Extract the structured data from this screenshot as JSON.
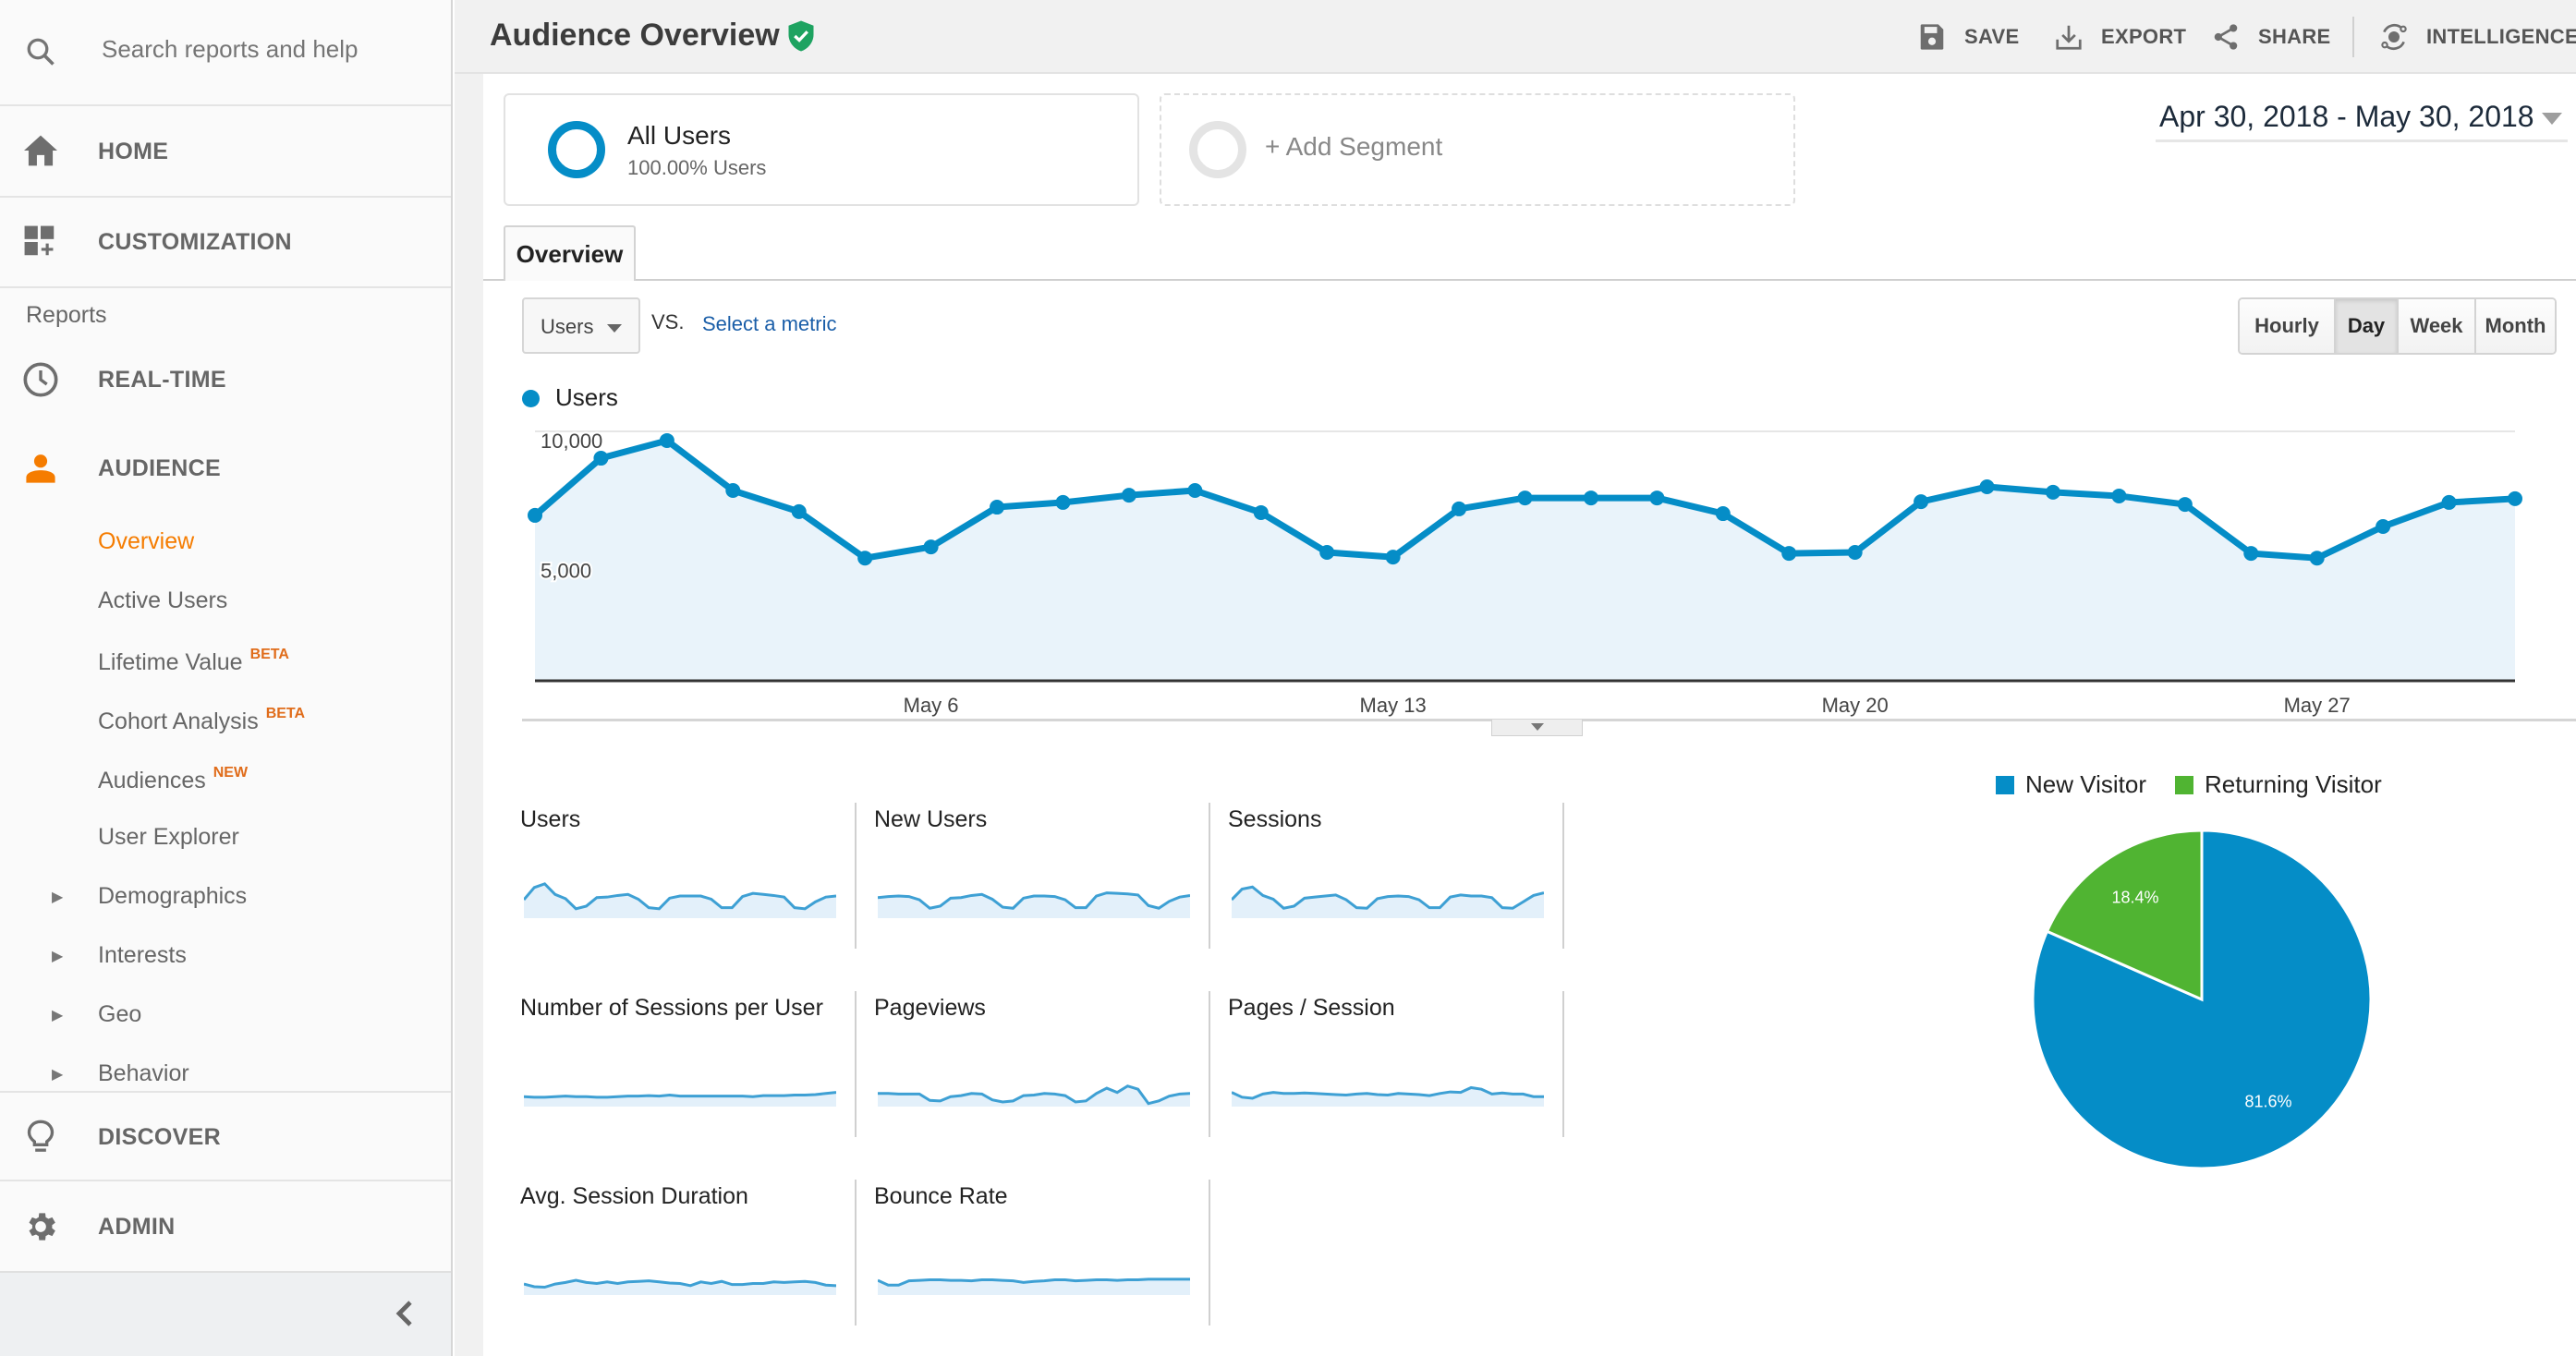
{
  "sidebar": {
    "search_placeholder": "Search reports and help",
    "home": "HOME",
    "customization": "CUSTOMIZATION",
    "reports_heading": "Reports",
    "realtime": "REAL-TIME",
    "audience": "AUDIENCE",
    "audience_items": [
      {
        "label": "Overview",
        "badge": "",
        "active": true
      },
      {
        "label": "Active Users",
        "badge": ""
      },
      {
        "label": "Lifetime Value",
        "badge": "BETA"
      },
      {
        "label": "Cohort Analysis",
        "badge": "BETA"
      },
      {
        "label": "Audiences",
        "badge": "NEW"
      },
      {
        "label": "User Explorer",
        "badge": ""
      }
    ],
    "expandable_items": [
      "Demographics",
      "Interests",
      "Geo",
      "Behavior"
    ],
    "discover": "DISCOVER",
    "admin": "ADMIN",
    "accent_color": "#f57c00"
  },
  "header": {
    "title": "Audience Overview",
    "verified_icon": "shield-check-icon",
    "actions": [
      {
        "label": "SAVE",
        "icon": "save-icon"
      },
      {
        "label": "EXPORT",
        "icon": "export-icon"
      },
      {
        "label": "SHARE",
        "icon": "share-icon"
      },
      {
        "label": "INTELLIGENCE",
        "icon": "intelligence-icon"
      }
    ]
  },
  "segments": {
    "active": {
      "title": "All Users",
      "subtitle": "100.00% Users"
    },
    "add_label": "+ Add Segment"
  },
  "date_range": "Apr 30, 2018 - May 30, 2018",
  "tabs": [
    "Overview"
  ],
  "metric_selector": {
    "selected": "Users",
    "vs_label": "VS.",
    "select_link": "Select a metric"
  },
  "granularity": {
    "options": [
      "Hourly",
      "Day",
      "Week",
      "Month"
    ],
    "selected": "Day"
  },
  "chart_data": [
    {
      "type": "area",
      "title": "",
      "legend": [
        "Users"
      ],
      "series": [
        {
          "name": "Users",
          "color": "#058dc7",
          "values": [
            6620,
            8920,
            9630,
            7620,
            6770,
            4900,
            5350,
            6950,
            7140,
            7430,
            7620,
            6730,
            5130,
            4940,
            6880,
            7320,
            7320,
            7320,
            6690,
            5090,
            5130,
            7170,
            7770,
            7550,
            7400,
            7060,
            5090,
            4900,
            6170,
            7140,
            7290
          ]
        }
      ],
      "x": [
        "Apr 30",
        "May 1",
        "May 2",
        "May 3",
        "May 4",
        "May 5",
        "May 6",
        "May 7",
        "May 8",
        "May 9",
        "May 10",
        "May 11",
        "May 12",
        "May 13",
        "May 14",
        "May 15",
        "May 16",
        "May 17",
        "May 18",
        "May 19",
        "May 20",
        "May 21",
        "May 22",
        "May 23",
        "May 24",
        "May 25",
        "May 26",
        "May 27",
        "May 28",
        "May 29",
        "May 30"
      ],
      "x_tick_labels": [
        "May 6",
        "May 13",
        "May 20",
        "May 27"
      ],
      "y_tick_labels": [
        "10,000",
        "5,000"
      ],
      "y_ticks": [
        10000,
        5000
      ],
      "ylim": [
        0,
        10000
      ],
      "grid": true
    },
    {
      "type": "pie",
      "legend": [
        "New Visitor",
        "Returning Visitor"
      ],
      "legend_position": "top",
      "slices": [
        {
          "label": "New Visitor",
          "value": 81.6,
          "display": "81.6%",
          "color": "#058dc7"
        },
        {
          "label": "Returning Visitor",
          "value": 18.4,
          "display": "18.4%",
          "color": "#50b432"
        }
      ]
    }
  ],
  "sparklines": [
    {
      "label": "Users",
      "values": [
        6.6,
        8.9,
        9.6,
        7.6,
        6.8,
        4.9,
        5.4,
        7.0,
        7.1,
        7.4,
        7.6,
        6.7,
        5.1,
        4.9,
        6.9,
        7.3,
        7.3,
        7.3,
        6.7,
        5.1,
        5.1,
        7.2,
        7.8,
        7.6,
        7.4,
        7.1,
        5.1,
        4.9,
        6.2,
        7.1,
        7.3
      ]
    },
    {
      "label": "New Users",
      "values": [
        7.0,
        7.2,
        7.3,
        7.2,
        6.6,
        5.0,
        5.4,
        6.9,
        7.0,
        7.4,
        7.6,
        6.7,
        5.2,
        5.0,
        6.9,
        7.3,
        7.3,
        7.2,
        6.6,
        5.1,
        5.1,
        7.3,
        7.9,
        7.8,
        7.7,
        7.5,
        5.5,
        5.0,
        6.3,
        7.1,
        7.4
      ]
    },
    {
      "label": "Sessions",
      "values": [
        6.6,
        8.6,
        9.0,
        7.4,
        6.7,
        5.0,
        5.4,
        6.9,
        7.1,
        7.3,
        7.5,
        6.6,
        5.1,
        5.0,
        6.8,
        7.2,
        7.3,
        7.2,
        6.6,
        5.1,
        5.1,
        7.1,
        7.5,
        7.3,
        7.3,
        7.0,
        5.1,
        5.0,
        6.2,
        7.4,
        7.9
      ]
    },
    {
      "label": "Number of Sessions per User",
      "values": [
        5.0,
        4.9,
        4.9,
        5.0,
        5.1,
        5.0,
        5.0,
        4.9,
        4.9,
        5.0,
        5.1,
        5.1,
        5.2,
        5.1,
        5.3,
        5.1,
        5.1,
        5.1,
        5.1,
        5.1,
        5.1,
        5.1,
        5.0,
        5.2,
        5.2,
        5.2,
        5.3,
        5.3,
        5.4,
        5.6,
        5.8
      ]
    },
    {
      "label": "Pageviews",
      "values": [
        5.6,
        5.6,
        5.5,
        5.5,
        5.5,
        4.3,
        4.2,
        5.0,
        5.2,
        5.6,
        5.5,
        4.4,
        4.0,
        4.2,
        5.2,
        5.3,
        5.6,
        5.5,
        5.2,
        4.0,
        4.2,
        5.6,
        6.6,
        5.8,
        7.0,
        6.4,
        3.7,
        4.2,
        5.1,
        5.5,
        5.6
      ]
    },
    {
      "label": "Pages / Session",
      "values": [
        5.8,
        4.9,
        4.7,
        5.5,
        5.8,
        5.6,
        5.6,
        5.7,
        5.6,
        5.5,
        5.4,
        5.3,
        5.5,
        5.6,
        5.4,
        5.3,
        5.6,
        5.5,
        5.4,
        5.2,
        5.6,
        5.9,
        5.8,
        6.7,
        6.4,
        5.5,
        5.7,
        5.5,
        5.5,
        5.0,
        5.0
      ]
    },
    {
      "label": "Avg. Session Duration",
      "values": [
        5.2,
        4.7,
        4.6,
        5.2,
        5.5,
        5.9,
        5.5,
        5.3,
        5.6,
        5.3,
        5.6,
        5.7,
        5.8,
        5.6,
        5.4,
        5.3,
        4.9,
        5.6,
        5.3,
        5.7,
        5.1,
        5.1,
        5.3,
        5.3,
        5.6,
        5.5,
        5.6,
        5.7,
        5.5,
        5.0,
        4.9
      ]
    },
    {
      "label": "Bounce Rate",
      "values": [
        5.9,
        5.0,
        5.0,
        5.8,
        5.9,
        6.0,
        6.0,
        5.9,
        5.9,
        5.8,
        6.0,
        6.0,
        5.9,
        5.8,
        5.5,
        5.7,
        5.8,
        6.0,
        6.0,
        5.8,
        5.9,
        6.0,
        6.0,
        5.9,
        6.0,
        6.0,
        6.1,
        6.1,
        6.1,
        6.1,
        6.1
      ]
    }
  ]
}
